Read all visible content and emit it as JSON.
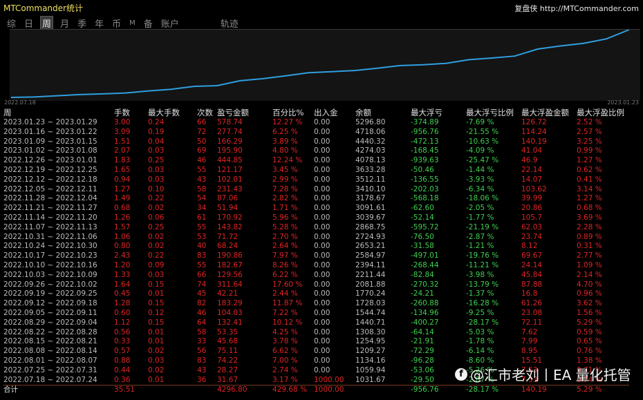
{
  "app": {
    "title": "MTCommander统计",
    "brand": "复盘侠 http://MTCommander.com"
  },
  "tabs": [
    {
      "label": "综",
      "active": false
    },
    {
      "label": "日",
      "active": false
    },
    {
      "label": "周",
      "active": true
    },
    {
      "label": "月",
      "active": false
    },
    {
      "label": "季",
      "active": false
    },
    {
      "label": "年",
      "active": false
    },
    {
      "label": "币",
      "active": false
    },
    {
      "label": "M",
      "active": false
    },
    {
      "label": "备",
      "active": false
    },
    {
      "label": "账户",
      "active": false
    },
    {
      "label": "轨迹",
      "active": false
    }
  ],
  "chart_data": {
    "type": "line",
    "series_color": "#2f9fe0",
    "x_start_label": "2022.07.18",
    "x_end_label": "2023.01.23",
    "x": [
      "2022.07.18",
      "2022.07.25",
      "2022.08.01",
      "2022.08.08",
      "2022.08.15",
      "2022.08.22",
      "2022.08.29",
      "2022.09.05",
      "2022.09.12",
      "2022.09.19",
      "2022.09.26",
      "2022.10.03",
      "2022.10.10",
      "2022.10.17",
      "2022.10.24",
      "2022.10.31",
      "2022.11.07",
      "2022.11.14",
      "2022.11.21",
      "2022.11.28",
      "2022.12.05",
      "2022.12.12",
      "2022.12.19",
      "2022.12.26",
      "2023.01.02",
      "2023.01.09",
      "2023.01.16",
      "2023.01.23"
    ],
    "values": [
      1031.67,
      1059.94,
      1134.16,
      1209.27,
      1254.95,
      1308.3,
      1440.71,
      1544.74,
      1728.03,
      1770.24,
      2081.88,
      2211.44,
      2394.11,
      2584.97,
      2653.21,
      2724.93,
      2868.75,
      3039.67,
      3091.61,
      3178.67,
      3410.1,
      3512.11,
      3633.28,
      4078.13,
      4274.03,
      4440.32,
      4718.06,
      5296.8
    ],
    "grid": false,
    "legend": "none"
  },
  "table": {
    "headers": [
      "周",
      "手数",
      "最大手数",
      "次数",
      "盈亏金额",
      "百分比%",
      "出入金",
      "余额",
      "最大浮亏",
      "最大浮亏比例",
      "最大浮盈金额",
      "最大浮盈比例"
    ],
    "rows": [
      [
        "2023.01.23 ~ 2023.01.29",
        "3.00",
        "0.24",
        "66",
        "578.74",
        "12.27 %",
        "0.00",
        "5296.80",
        "-374.89",
        "-7.69 %",
        "126.72",
        "2.52 %"
      ],
      [
        "2023.01.16 ~ 2023.01.22",
        "3.09",
        "0.19",
        "72",
        "277.74",
        "6.25 %",
        "0.00",
        "4718.06",
        "-956.76",
        "-21.55 %",
        "114.24",
        "2.57 %"
      ],
      [
        "2023.01.09 ~ 2023.01.15",
        "1.51",
        "0.04",
        "50",
        "166.29",
        "3.89 %",
        "0.00",
        "4440.32",
        "-472.13",
        "-10.63 %",
        "140.19",
        "3.25 %"
      ],
      [
        "2023.01.02 ~ 2023.01.08",
        "2.07",
        "0.03",
        "69",
        "195.90",
        "4.80 %",
        "0.00",
        "4274.03",
        "-168.45",
        "-4.09 %",
        "41.04",
        "0.99 %"
      ],
      [
        "2022.12.26 ~ 2023.01.01",
        "1.83",
        "0.25",
        "46",
        "444.85",
        "12.24 %",
        "0.00",
        "4078.13",
        "-939.63",
        "-25.47 %",
        "46.9",
        "1.27 %"
      ],
      [
        "2022.12.19 ~ 2022.12.25",
        "1.65",
        "0.03",
        "55",
        "121.17",
        "3.45 %",
        "0.00",
        "3633.28",
        "-50.46",
        "-1.44 %",
        "22.14",
        "0.62 %"
      ],
      [
        "2022.12.12 ~ 2022.12.18",
        "0.94",
        "0.03",
        "43",
        "102.01",
        "2.99 %",
        "0.00",
        "3512.11",
        "-136.55",
        "-3.93 %",
        "14.07",
        "0.41 %"
      ],
      [
        "2022.12.05 ~ 2022.12.11",
        "1.27",
        "0.10",
        "58",
        "231.43",
        "7.28 %",
        "0.00",
        "3410.10",
        "-202.03",
        "-6.34 %",
        "103.62",
        "3.14 %"
      ],
      [
        "2022.11.28 ~ 2022.12.04",
        "1.49",
        "0.22",
        "54",
        "87.06",
        "2.82 %",
        "0.00",
        "3178.67",
        "-568.18",
        "-18.06 %",
        "39.99",
        "1.27 %"
      ],
      [
        "2022.11.21 ~ 2022.11.27",
        "0.68",
        "0.02",
        "34",
        "51.94",
        "1.71 %",
        "0.00",
        "3091.61",
        "-62.60",
        "-2.05 %",
        "20.86",
        "0.68 %"
      ],
      [
        "2022.11.14 ~ 2022.11.20",
        "1.26",
        "0.06",
        "61",
        "170.92",
        "5.96 %",
        "0.00",
        "3039.67",
        "-52.14",
        "-1.77 %",
        "105.7",
        "3.69 %"
      ],
      [
        "2022.11.07 ~ 2022.11.13",
        "1.57",
        "0.25",
        "55",
        "143.82",
        "5.28 %",
        "0.00",
        "2868.75",
        "-595.72",
        "-21.19 %",
        "62.03",
        "2.28 %"
      ],
      [
        "2022.10.31 ~ 2022.11.06",
        "1.06",
        "0.02",
        "53",
        "71.72",
        "2.70 %",
        "0.00",
        "2724.93",
        "-76.50",
        "-2.87 %",
        "23.74",
        "0.89 %"
      ],
      [
        "2022.10.24 ~ 2022.10.30",
        "0.80",
        "0.02",
        "40",
        "68.24",
        "2.64 %",
        "0.00",
        "2653.21",
        "-31.58",
        "-1.21 %",
        "8.12",
        "0.31 %"
      ],
      [
        "2022.10.17 ~ 2022.10.23",
        "2.43",
        "0.22",
        "83",
        "190.86",
        "7.97 %",
        "0.00",
        "2584.97",
        "-497.01",
        "-19.76 %",
        "69.67",
        "2.77 %"
      ],
      [
        "2022.10.10 ~ 2022.10.16",
        "1.20",
        "0.09",
        "55",
        "182.67",
        "8.26 %",
        "0.00",
        "2394.11",
        "-268.44",
        "-11.21 %",
        "24.14",
        "1.09 %"
      ],
      [
        "2022.10.03 ~ 2022.10.09",
        "1.33",
        "0.03",
        "66",
        "129.56",
        "6.22 %",
        "0.00",
        "2211.44",
        "-82.84",
        "-3.98 %",
        "45.84",
        "2.14 %"
      ],
      [
        "2022.09.26 ~ 2022.10.02",
        "1.64",
        "0.15",
        "74",
        "311.64",
        "17.60 %",
        "0.00",
        "2081.88",
        "-270.32",
        "-13.79 %",
        "87.88",
        "4.70 %"
      ],
      [
        "2022.09.19 ~ 2022.09.25",
        "0.45",
        "0.01",
        "45",
        "42.21",
        "2.44 %",
        "0.00",
        "1770.24",
        "-24.21",
        "-1.37 %",
        "16.8",
        "0.96 %"
      ],
      [
        "2022.09.12 ~ 2022.09.18",
        "1.28",
        "0.15",
        "82",
        "183.29",
        "11.87 %",
        "0.00",
        "1728.03",
        "-260.88",
        "-16.28 %",
        "61.26",
        "3.62 %"
      ],
      [
        "2022.09.05 ~ 2022.09.11",
        "0.60",
        "0.12",
        "46",
        "104.03",
        "7.22 %",
        "0.00",
        "1544.74",
        "-134.96",
        "-9.25 %",
        "23.08",
        "1.56 %"
      ],
      [
        "2022.08.29 ~ 2022.09.04",
        "1.12",
        "0.15",
        "64",
        "132.41",
        "10.12 %",
        "0.00",
        "1440.71",
        "-400.27",
        "-28.17 %",
        "72.11",
        "5.29 %"
      ],
      [
        "2022.08.22 ~ 2022.08.28",
        "0.56",
        "0.01",
        "58",
        "53.35",
        "4.25 %",
        "0.00",
        "1308.30",
        "-64.14",
        "-5.03 %",
        "7.62",
        "0.59 %"
      ],
      [
        "2022.08.15 ~ 2022.08.21",
        "0.33",
        "0.01",
        "33",
        "45.68",
        "3.78 %",
        "0.00",
        "1254.95",
        "-21.91",
        "-1.78 %",
        "7.99",
        "0.65 %"
      ],
      [
        "2022.08.08 ~ 2022.08.14",
        "0.57",
        "0.02",
        "56",
        "75.11",
        "6.62 %",
        "0.00",
        "1209.27",
        "-72.29",
        "-6.14 %",
        "8.95",
        "0.76 %"
      ],
      [
        "2022.08.01 ~ 2022.08.07",
        "0.88",
        "0.03",
        "83",
        "74.22",
        "7.00 %",
        "0.00",
        "1134.16",
        "-96.28",
        "-8.60 %",
        "15.51",
        "1.38 %"
      ],
      [
        "2022.07.25 ~ 2022.07.31",
        "0.44",
        "0.02",
        "43",
        "28.27",
        "2.74 %",
        "0.00",
        "1059.94",
        "-53.06",
        "-5.26 %",
        "7.53",
        "0.71 %"
      ],
      [
        "2022.07.18 ~ 2022.07.24",
        "0.36",
        "0.01",
        "36",
        "31.67",
        "3.17 %",
        "1000.00",
        "1031.67",
        "-29.50",
        "-2.87 %",
        "7.53",
        "0.74 %"
      ]
    ],
    "total": [
      "合计",
      "35.51",
      "",
      "",
      "4296.80",
      "429.68 %",
      "1000.00",
      "",
      "-956.76",
      "-28.17 %",
      "140.19",
      "5.29 %"
    ]
  },
  "watermark": {
    "icon": "facebook-icon",
    "text": "@汇市老刘丨EA 量化托管"
  }
}
